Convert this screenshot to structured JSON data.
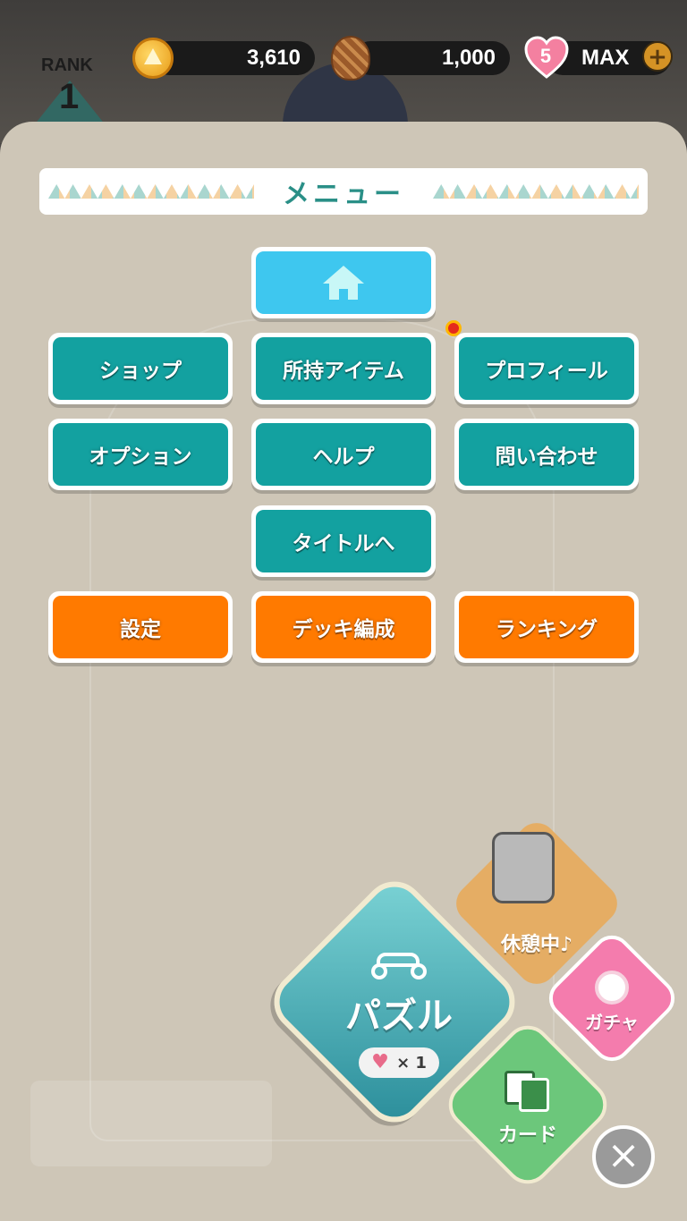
{
  "header": {
    "rank_label": "RANK",
    "rank_value": "1",
    "coins": "3,610",
    "pinecones": "1,000",
    "hearts_count": "5",
    "hearts_status": "MAX",
    "add_label": "+"
  },
  "menu": {
    "title": "メニュー",
    "items": {
      "shop": "ショップ",
      "items_owned": "所持アイテム",
      "profile": "プロフィール",
      "options": "オプション",
      "help": "ヘルプ",
      "contact": "問い合わせ",
      "to_title": "タイトルへ",
      "settings": "設定",
      "deck": "デッキ編成",
      "ranking": "ランキング"
    }
  },
  "actions": {
    "puzzle_label": "パズル",
    "puzzle_cost": "× 1",
    "rest_label": "休憩中♪",
    "gacha_label": "ガチャ",
    "card_label": "カード",
    "close_label": "×"
  },
  "colors": {
    "teal": "#13a1a0",
    "orange": "#ff7a00",
    "sky": "#3ec7ef",
    "panel": "#cec6b7"
  }
}
